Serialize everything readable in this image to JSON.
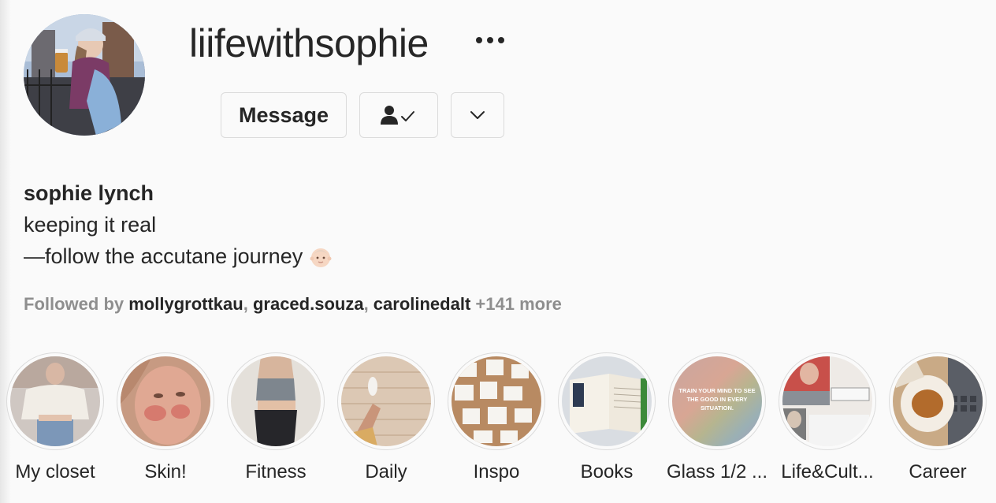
{
  "profile": {
    "username": "liifewithsophie",
    "full_name": "sophie lynch",
    "bio_line_1": "keeping it real",
    "bio_line_2": "—follow the accutane journey",
    "bio_emoji_icon": "baby-emoji-icon"
  },
  "actions": {
    "message_label": "Message",
    "following_icon": "person-check-icon",
    "suggest_icon": "chevron-down-icon",
    "more_icon": "more-dots-icon"
  },
  "followed_by": {
    "prefix": "Followed by",
    "accounts": [
      "mollygrottkau",
      "graced.souza",
      "carolinedalt"
    ],
    "separator": ", ",
    "more": "+141 more"
  },
  "highlights": [
    {
      "label": "My closet"
    },
    {
      "label": "Skin!"
    },
    {
      "label": "Fitness"
    },
    {
      "label": "Daily"
    },
    {
      "label": "Inspo"
    },
    {
      "label": "Books"
    },
    {
      "label": "Glass 1/2 ..."
    },
    {
      "label": "Life&Cult..."
    },
    {
      "label": "Career"
    }
  ],
  "highlight_texts": {
    "glass_caption": "TRAIN YOUR MIND TO SEE THE GOOD IN EVERY SITUATION."
  },
  "colors": {
    "background": "#fafafa",
    "text": "#262626",
    "muted": "#8e8e8e",
    "border": "#dbdbdb"
  }
}
